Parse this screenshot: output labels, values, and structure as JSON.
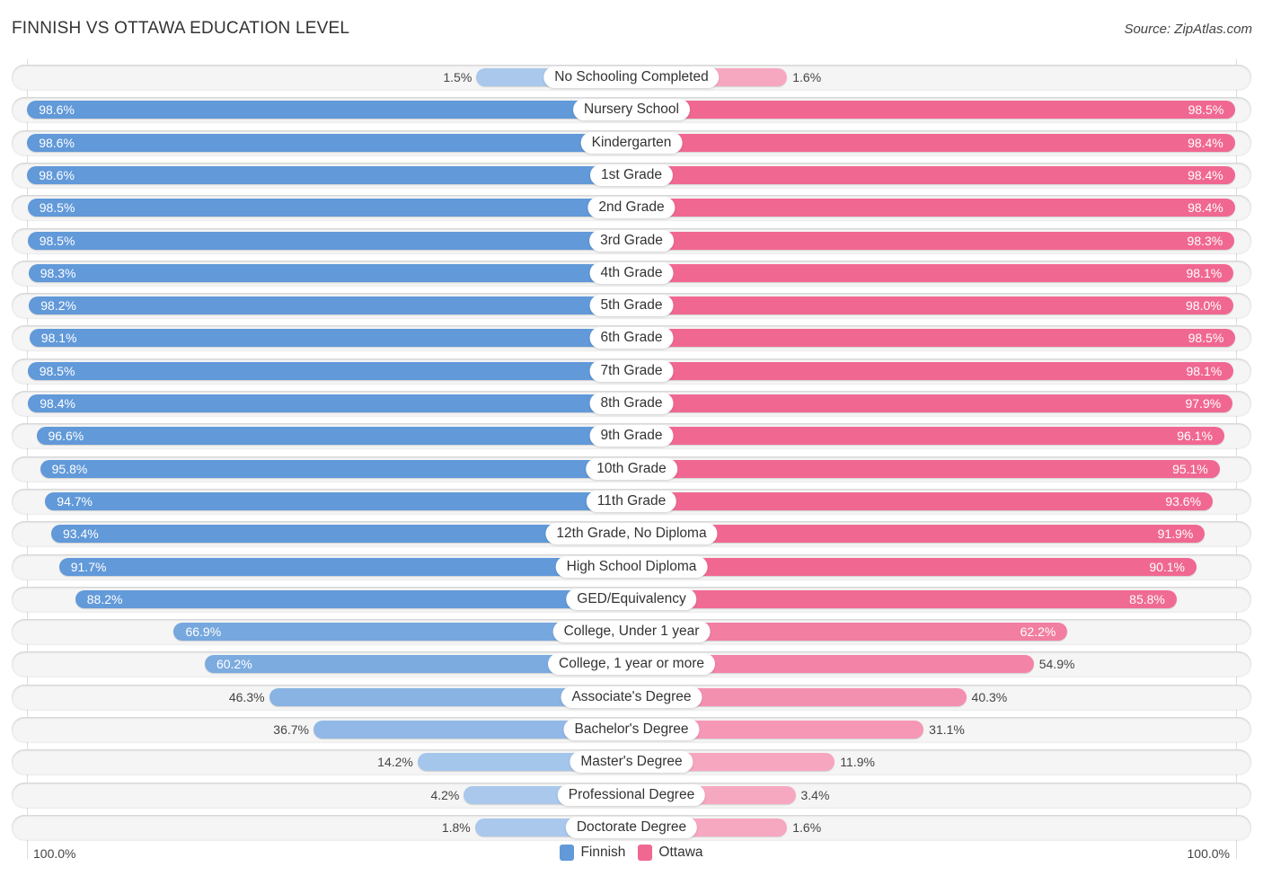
{
  "header": {
    "title": "FINNISH VS OTTAWA EDUCATION LEVEL",
    "source": "Source: ZipAtlas.com"
  },
  "colors": {
    "finnish_strong": "#6199d9",
    "finnish_light": "#a9c8ec",
    "ottawa_strong": "#f06892",
    "ottawa_light": "#f7a8c1"
  },
  "axis": {
    "left_label": "100.0%",
    "right_label": "100.0%"
  },
  "legend": [
    {
      "name": "Finnish",
      "color": "#6199d9"
    },
    {
      "name": "Ottawa",
      "color": "#f06892"
    }
  ],
  "chart_data": {
    "type": "bar",
    "orientation": "horizontal-diverging",
    "title": "FINNISH VS OTTAWA EDUCATION LEVEL",
    "source": "Source: ZipAtlas.com",
    "xlim": [
      0,
      100
    ],
    "x_unit": "%",
    "legend_position": "bottom-center",
    "categories": [
      "No Schooling Completed",
      "Nursery School",
      "Kindergarten",
      "1st Grade",
      "2nd Grade",
      "3rd Grade",
      "4th Grade",
      "5th Grade",
      "6th Grade",
      "7th Grade",
      "8th Grade",
      "9th Grade",
      "10th Grade",
      "11th Grade",
      "12th Grade, No Diploma",
      "High School Diploma",
      "GED/Equivalency",
      "College, Under 1 year",
      "College, 1 year or more",
      "Associate's Degree",
      "Bachelor's Degree",
      "Master's Degree",
      "Professional Degree",
      "Doctorate Degree"
    ],
    "series": [
      {
        "name": "Finnish",
        "side": "left",
        "values": [
          1.5,
          98.6,
          98.6,
          98.6,
          98.5,
          98.5,
          98.3,
          98.2,
          98.1,
          98.5,
          98.4,
          96.6,
          95.8,
          94.7,
          93.4,
          91.7,
          88.2,
          66.9,
          60.2,
          46.3,
          36.7,
          14.2,
          4.2,
          1.8
        ]
      },
      {
        "name": "Ottawa",
        "side": "right",
        "values": [
          1.6,
          98.5,
          98.4,
          98.4,
          98.4,
          98.3,
          98.1,
          98.0,
          98.5,
          98.1,
          97.9,
          96.1,
          95.1,
          93.6,
          91.9,
          90.1,
          85.8,
          62.2,
          54.9,
          40.3,
          31.1,
          11.9,
          3.4,
          1.6
        ]
      }
    ]
  }
}
